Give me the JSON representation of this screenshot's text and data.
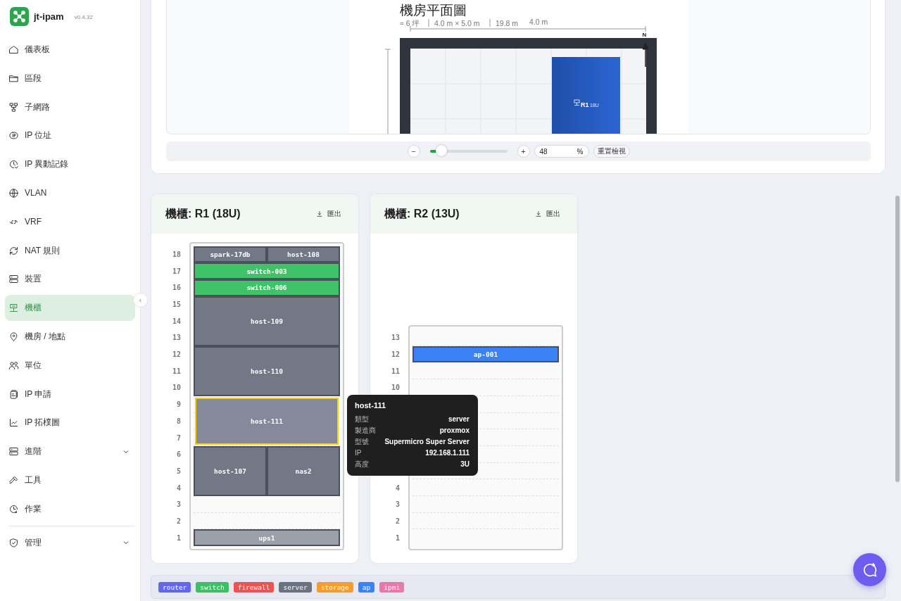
{
  "sidebar": {
    "app_name": "jt-ipam",
    "version": "v0.4.32",
    "items": [
      {
        "label": "儀表板",
        "selected": false,
        "expandable": false
      },
      {
        "label": "區段",
        "selected": false,
        "expandable": false
      },
      {
        "label": "子網路",
        "selected": false,
        "expandable": false
      },
      {
        "label": "IP 位址",
        "selected": false,
        "expandable": false
      },
      {
        "label": "IP 異動記錄",
        "selected": false,
        "expandable": false
      },
      {
        "label": "VLAN",
        "selected": false,
        "expandable": false
      },
      {
        "label": "VRF",
        "selected": false,
        "expandable": false
      },
      {
        "label": "NAT 規則",
        "selected": false,
        "expandable": false
      },
      {
        "label": "裝置",
        "selected": false,
        "expandable": false
      },
      {
        "label": "機櫃",
        "selected": true,
        "expandable": false
      },
      {
        "label": "機房 / 地點",
        "selected": false,
        "expandable": false
      },
      {
        "label": "單位",
        "selected": false,
        "expandable": false
      },
      {
        "label": "IP 申請",
        "selected": false,
        "expandable": false
      },
      {
        "label": "IP 拓樸圖",
        "selected": false,
        "expandable": false
      },
      {
        "label": "進階",
        "selected": false,
        "expandable": true
      },
      {
        "label": "工具",
        "selected": false,
        "expandable": false
      },
      {
        "label": "作業",
        "selected": false,
        "expandable": false
      }
    ],
    "admin_items": [
      {
        "label": "管理",
        "selected": false,
        "expandable": true
      }
    ]
  },
  "floor_plan": {
    "title": "機房平面圖",
    "stats": [
      "≈ 6 坪",
      "4.0 m × 5.0 m",
      "19.8 m"
    ],
    "width_label": "4.0 m",
    "compass": "N",
    "racks": [
      {
        "name": "R1",
        "size": "18U"
      }
    ],
    "zoom": {
      "minus": "−",
      "plus": "+",
      "level": 0.15,
      "value": "48",
      "unit": "%",
      "reset": "重置檢視"
    }
  },
  "racks": [
    {
      "title": "機櫃: R1 (18U)",
      "export": "匯出",
      "slots": [
        {
          "units": [
            "18"
          ],
          "devices": [
            {
              "name": "spark-17db",
              "color": "#727886",
              "selected": false
            },
            {
              "name": "host-108",
              "color": "#727886",
              "selected": false
            }
          ]
        },
        {
          "units": [
            "17"
          ],
          "devices": [
            {
              "name": "switch-003",
              "color": "#3fc368",
              "selected": false
            }
          ]
        },
        {
          "units": [
            "16"
          ],
          "devices": [
            {
              "name": "switch-006",
              "color": "#3fc368",
              "selected": false
            }
          ]
        },
        {
          "units": [
            "15",
            "14",
            "13"
          ],
          "devices": [
            {
              "name": "host-109",
              "color": "#727886",
              "selected": false
            }
          ]
        },
        {
          "units": [
            "12",
            "11",
            "10"
          ],
          "devices": [
            {
              "name": "host-110",
              "color": "#727886",
              "selected": false
            }
          ]
        },
        {
          "units": [
            "9",
            "8",
            "7"
          ],
          "devices": [
            {
              "name": "host-111",
              "color": "#848a9a",
              "selected": true
            }
          ]
        },
        {
          "units": [
            "6",
            "5",
            "4"
          ],
          "devices": [
            {
              "name": "host-107",
              "color": "#727886",
              "selected": false
            },
            {
              "name": "nas2",
              "color": "#727886",
              "selected": false
            }
          ]
        },
        {
          "units": [
            "3"
          ]
        },
        {
          "units": [
            "2"
          ]
        },
        {
          "units": [
            "1"
          ],
          "devices": [
            {
              "name": "ups1",
              "color": "#9ca0a8",
              "selected": false
            }
          ]
        }
      ],
      "tooltip": {
        "title": "host-111",
        "rows": [
          {
            "label": "類型",
            "value": "server"
          },
          {
            "label": "製造商",
            "value": "proxmox"
          },
          {
            "label": "型號",
            "value": "Supermicro Super Server"
          },
          {
            "label": "IP",
            "value": "192.168.1.111"
          },
          {
            "label": "高度",
            "value": "3U"
          }
        ]
      }
    },
    {
      "title": "機櫃: R2 (13U)",
      "export": "匯出",
      "slots": [
        {
          "units": [
            "13"
          ]
        },
        {
          "units": [
            "12"
          ],
          "devices": [
            {
              "name": "ap-001",
              "color": "#3b82f6",
              "selected": false
            }
          ]
        },
        {
          "units": [
            "11"
          ]
        },
        {
          "units": [
            "10"
          ]
        },
        {
          "covered": true
        },
        {
          "covered": true
        },
        {
          "covered": true
        },
        {
          "covered": true
        },
        {
          "covered": true
        },
        {
          "units": [
            "4"
          ]
        },
        {
          "units": [
            "3"
          ]
        },
        {
          "units": [
            "2"
          ]
        },
        {
          "units": [
            "1"
          ]
        }
      ]
    }
  ],
  "legend": [
    {
      "label": "router",
      "color": "#6366f1"
    },
    {
      "label": "switch",
      "color": "#3dbf63"
    },
    {
      "label": "firewall",
      "color": "#ef5350"
    },
    {
      "label": "server",
      "color": "#6b7280"
    },
    {
      "label": "storage",
      "color": "#f59e2b"
    },
    {
      "label": "ap",
      "color": "#3b82f6"
    },
    {
      "label": "ipmi",
      "color": "#e879a9"
    }
  ]
}
